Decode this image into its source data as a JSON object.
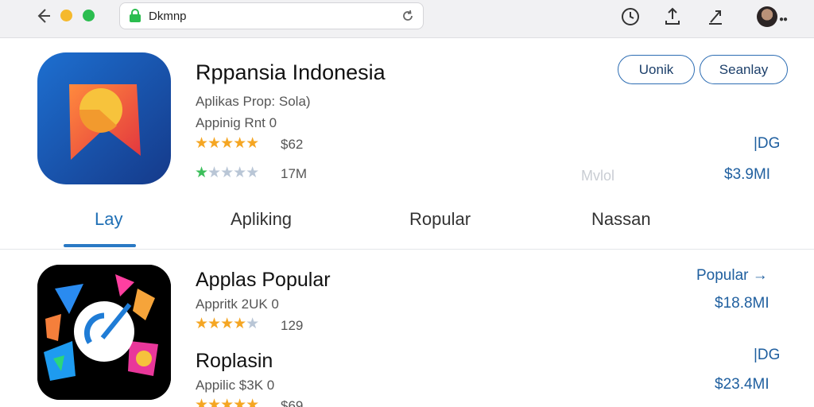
{
  "browser": {
    "url": "Dkmnp",
    "icons": [
      "back-arrow-icon",
      "lock-icon",
      "reload-icon",
      "clock-icon",
      "download-icon",
      "share-icon",
      "avatar"
    ]
  },
  "app": {
    "title": "Rppansia Indonesia",
    "line1": "Aplikas Prop: Sola)",
    "line2": "Appinig Rnt 0",
    "rating_text": "$62",
    "rating_stars": 5,
    "reviews_text": "17M",
    "reviews_stars_filled": 1,
    "buttons": {
      "primary": "Uonik",
      "secondary": "Seanlay"
    },
    "right_top": "|DG",
    "right_faded": "Mvlol",
    "right_price": "$3.9MI"
  },
  "tabs": [
    {
      "label": "Lay",
      "active": true
    },
    {
      "label": "Apliking",
      "active": false
    },
    {
      "label": "Ropular",
      "active": false
    },
    {
      "label": "Nassan",
      "active": false
    }
  ],
  "list": [
    {
      "title": "Applas Popular",
      "sub": "Appritk 2UK 0",
      "rating_text": "129",
      "right_link": "Popular →",
      "price": "$18.8MI"
    },
    {
      "title": "Roplasin",
      "sub": "Appilic $3K 0",
      "rating_text": "$69",
      "right_link": "|DG",
      "price": "$23.4MI"
    }
  ],
  "colors": {
    "accent": "#1f6fb5",
    "star": "#f5a623",
    "star_green": "#3cbf5b",
    "lock_green": "#2bbd4f"
  }
}
